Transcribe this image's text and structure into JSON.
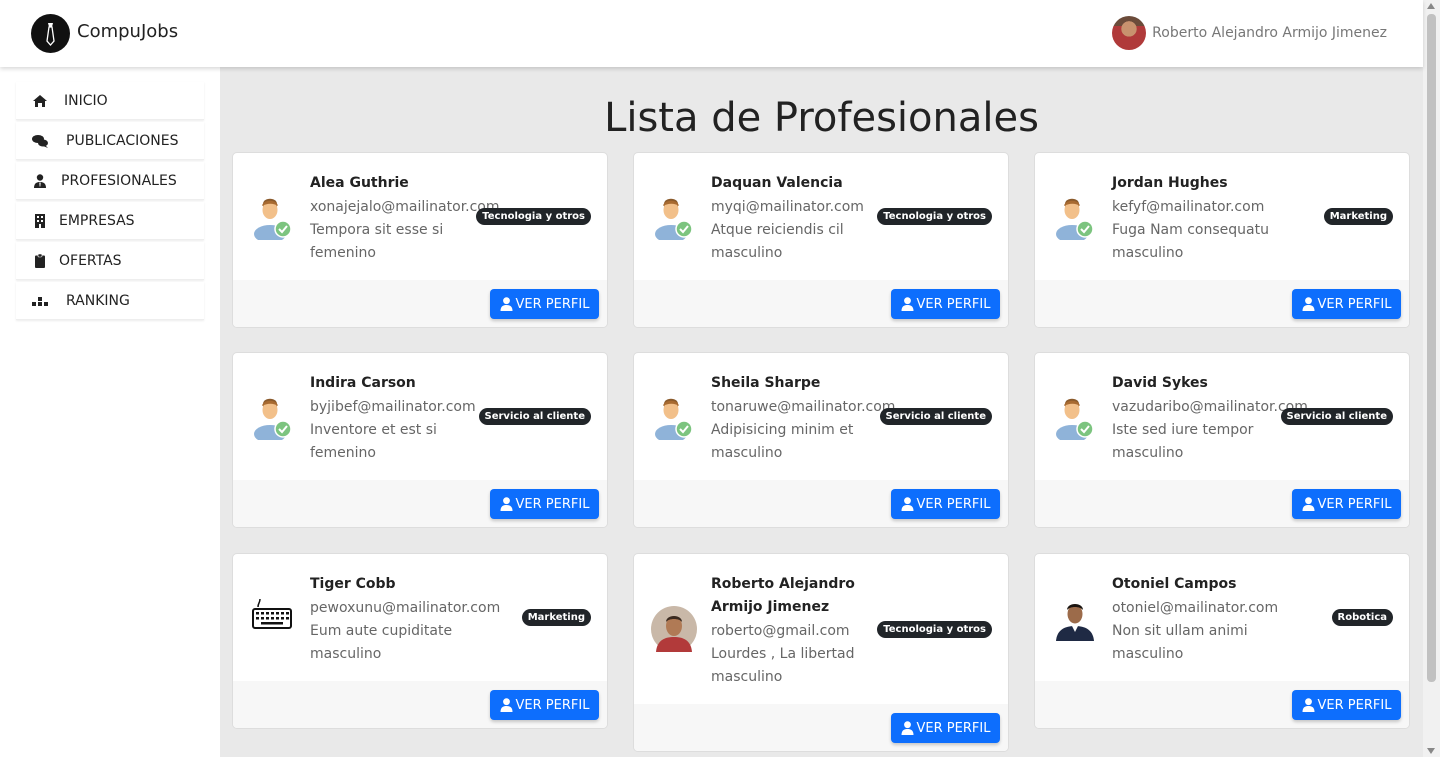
{
  "header": {
    "brand": "CompuJobs",
    "user_name": "Roberto Alejandro Armijo Jimenez"
  },
  "sidebar": {
    "items": [
      {
        "label": "INICIO",
        "icon": "home-icon"
      },
      {
        "label": "PUBLICACIONES",
        "icon": "comments-icon"
      },
      {
        "label": "PROFESIONALES",
        "icon": "user-tie-icon"
      },
      {
        "label": "EMPRESAS",
        "icon": "building-icon"
      },
      {
        "label": "OFERTAS",
        "icon": "clipboard-icon"
      },
      {
        "label": "RANKING",
        "icon": "podium-icon"
      }
    ]
  },
  "main": {
    "title": "Lista de Profesionales",
    "button_label": "VER PERFIL",
    "cards": [
      {
        "name": "Alea Guthrie",
        "email": "xonajejalo@mailinator.com",
        "desc": "Tempora sit esse si",
        "gender": "femenino",
        "badge": "Tecnologia y otros",
        "avatar": "default-user-icon"
      },
      {
        "name": "Daquan Valencia",
        "email": "myqi@mailinator.com",
        "desc": "Atque reiciendis cil",
        "gender": "masculino",
        "badge": "Tecnologia y otros",
        "avatar": "default-user-icon"
      },
      {
        "name": "Jordan Hughes",
        "email": "kefyf@mailinator.com",
        "desc": "Fuga Nam consequatu",
        "gender": "masculino",
        "badge": "Marketing",
        "avatar": "default-user-icon"
      },
      {
        "name": "Indira Carson",
        "email": "byjibef@mailinator.com",
        "desc": "Inventore et est si",
        "gender": "femenino",
        "badge": "Servicio al cliente",
        "avatar": "default-user-icon"
      },
      {
        "name": "Sheila Sharpe",
        "email": "tonaruwe@mailinator.com",
        "desc": "Adipisicing minim et",
        "gender": "masculino",
        "badge": "Servicio al cliente",
        "avatar": "default-user-icon"
      },
      {
        "name": "David Sykes",
        "email": "vazudaribo@mailinator.com",
        "desc": "Iste sed iure tempor",
        "gender": "masculino",
        "badge": "Servicio al cliente",
        "avatar": "default-user-icon"
      },
      {
        "name": "Tiger Cobb",
        "email": "pewoxunu@mailinator.com",
        "desc": "Eum aute cupiditate",
        "gender": "masculino",
        "badge": "Marketing",
        "avatar": "keyboard-icon"
      },
      {
        "name": "Roberto Alejandro Armijo Jimenez",
        "email": "roberto@gmail.com",
        "desc": "Lourdes , La libertad",
        "gender": "masculino",
        "badge": "Tecnologia y otros",
        "avatar": "profile-photo"
      },
      {
        "name": "Otoniel Campos",
        "email": "otoniel@mailinator.com",
        "desc": "Non sit ullam animi",
        "gender": "masculino",
        "badge": "Robotica",
        "avatar": "profile-photo"
      }
    ]
  }
}
